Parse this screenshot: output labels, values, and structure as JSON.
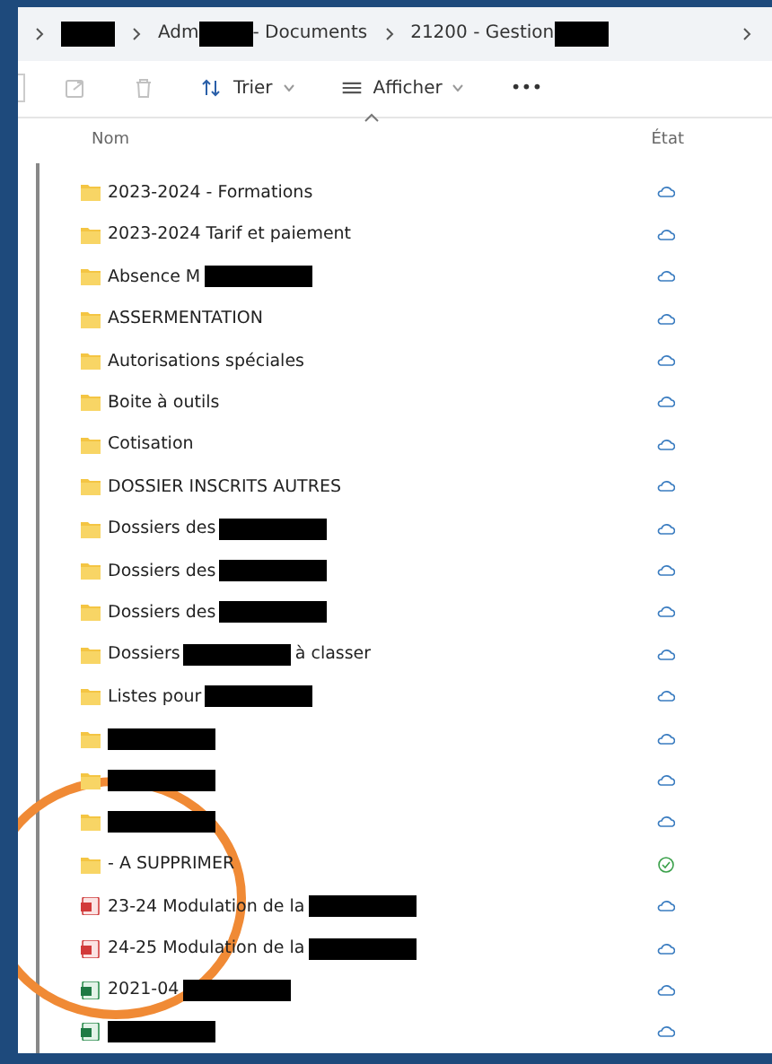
{
  "breadcrumbs": [
    {
      "parts": [
        {
          "kind": "redaction"
        }
      ]
    },
    {
      "parts": [
        {
          "kind": "text",
          "text": "Adm"
        },
        {
          "kind": "redaction"
        },
        {
          "kind": "text",
          "text": "- Documents"
        }
      ]
    },
    {
      "parts": [
        {
          "kind": "text",
          "text": "21200 - Gestion"
        },
        {
          "kind": "redaction"
        }
      ]
    }
  ],
  "toolbar": [
    {
      "kind": "share"
    },
    {
      "kind": "delete"
    },
    {
      "kind": "sort",
      "label": "Trier"
    },
    {
      "kind": "view",
      "label": "Afficher"
    },
    {
      "kind": "more",
      "label": "•••"
    }
  ],
  "columns": [
    {
      "label": "Nom"
    },
    {
      "label": "État"
    }
  ],
  "rows": [
    {
      "kind": "folder",
      "synced": false,
      "parts": [
        {
          "kind": "text",
          "text": "2023-2024 - Formations"
        }
      ]
    },
    {
      "kind": "folder",
      "synced": false,
      "parts": [
        {
          "kind": "text",
          "text": "2023-2024 Tarif et paiement"
        }
      ]
    },
    {
      "kind": "folder",
      "synced": false,
      "parts": [
        {
          "kind": "text",
          "text": "Absence M"
        },
        {
          "kind": "redaction"
        }
      ]
    },
    {
      "kind": "folder",
      "synced": false,
      "parts": [
        {
          "kind": "text",
          "text": "ASSERMENTATION"
        }
      ]
    },
    {
      "kind": "folder",
      "synced": false,
      "parts": [
        {
          "kind": "text",
          "text": "Autorisations spéciales"
        }
      ]
    },
    {
      "kind": "folder",
      "synced": false,
      "parts": [
        {
          "kind": "text",
          "text": "Boite à outils"
        }
      ]
    },
    {
      "kind": "folder",
      "synced": false,
      "parts": [
        {
          "kind": "text",
          "text": "Cotisation"
        }
      ]
    },
    {
      "kind": "folder",
      "synced": false,
      "parts": [
        {
          "kind": "text",
          "text": "DOSSIER INSCRITS AUTRES"
        }
      ]
    },
    {
      "kind": "folder",
      "synced": false,
      "parts": [
        {
          "kind": "text",
          "text": "Dossiers des"
        },
        {
          "kind": "redaction"
        }
      ]
    },
    {
      "kind": "folder",
      "synced": false,
      "parts": [
        {
          "kind": "text",
          "text": "Dossiers des"
        },
        {
          "kind": "redaction"
        }
      ]
    },
    {
      "kind": "folder",
      "synced": false,
      "parts": [
        {
          "kind": "text",
          "text": "Dossiers des"
        },
        {
          "kind": "redaction"
        }
      ]
    },
    {
      "kind": "folder",
      "synced": false,
      "parts": [
        {
          "kind": "text",
          "text": "Dossiers"
        },
        {
          "kind": "redaction"
        },
        {
          "kind": "text",
          "text": "à classer"
        }
      ]
    },
    {
      "kind": "folder",
      "synced": false,
      "parts": [
        {
          "kind": "text",
          "text": "Listes pour"
        },
        {
          "kind": "redaction"
        }
      ]
    },
    {
      "kind": "folder",
      "synced": false,
      "parts": [
        {
          "kind": "redaction"
        }
      ]
    },
    {
      "kind": "folder",
      "synced": false,
      "parts": [
        {
          "kind": "redaction"
        }
      ]
    },
    {
      "kind": "folder",
      "synced": false,
      "parts": [
        {
          "kind": "redaction"
        }
      ]
    },
    {
      "kind": "folder",
      "synced": true,
      "parts": [
        {
          "kind": "text",
          "text": "- A SUPPRIMER"
        }
      ]
    },
    {
      "kind": "pdf",
      "synced": false,
      "parts": [
        {
          "kind": "text",
          "text": "23-24 Modulation de la"
        },
        {
          "kind": "redaction"
        }
      ]
    },
    {
      "kind": "pdf",
      "synced": false,
      "parts": [
        {
          "kind": "text",
          "text": "24-25 Modulation de la"
        },
        {
          "kind": "redaction"
        }
      ]
    },
    {
      "kind": "excel",
      "synced": false,
      "parts": [
        {
          "kind": "text",
          "text": "2021-04"
        },
        {
          "kind": "redaction"
        }
      ]
    },
    {
      "kind": "excel",
      "synced": false,
      "parts": [
        {
          "kind": "redaction"
        }
      ]
    }
  ],
  "annotation": {
    "kind": "circle"
  }
}
